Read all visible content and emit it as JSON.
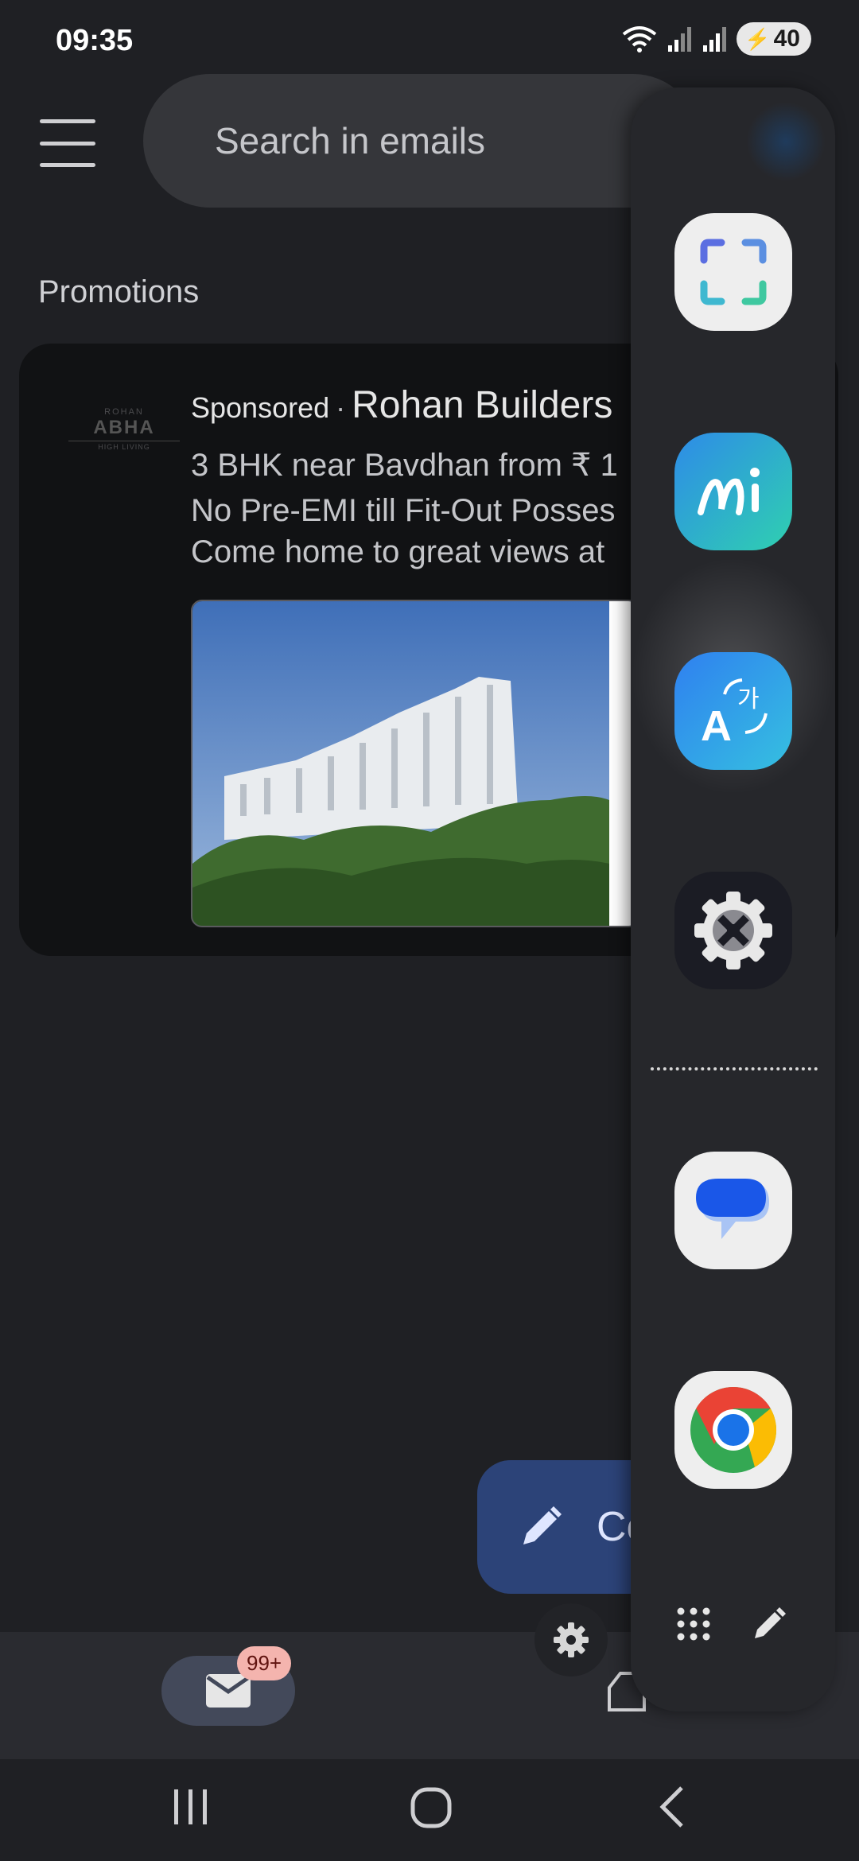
{
  "status_bar": {
    "time": "09:35",
    "battery": "40"
  },
  "search": {
    "placeholder": "Search in emails"
  },
  "section": {
    "title": "Promotions"
  },
  "promo": {
    "logo_lines": [
      "ROHAN",
      "ABHA",
      "HIGH LIVING"
    ],
    "sponsored_label": "Sponsored",
    "separator": "·",
    "advertiser": "Rohan Builders",
    "line1": "3 BHK near Bavdhan from ₹ 1",
    "line2": "No Pre-EMI till Fit-Out Posses",
    "line3": "Come home to great views at"
  },
  "compose": {
    "label": "Co"
  },
  "bottom_nav": {
    "mail_badge": "99+"
  },
  "edge_panel": {
    "apps": [
      {
        "name": "Smart select",
        "icon": "screenshot-frame-icon"
      },
      {
        "name": "Galaxy AI",
        "icon": "ai-icon"
      },
      {
        "name": "Translate",
        "icon": "translate-icon"
      },
      {
        "name": "Settings",
        "icon": "settings-gear-icon"
      },
      {
        "name": "Messages",
        "icon": "messages-icon"
      },
      {
        "name": "Chrome",
        "icon": "chrome-icon"
      }
    ]
  },
  "colors": {
    "background": "#1f2024",
    "card": "#111214",
    "compose": "#2c4378",
    "badge": "#f4b4ae",
    "edge_panel": "#26272b"
  }
}
